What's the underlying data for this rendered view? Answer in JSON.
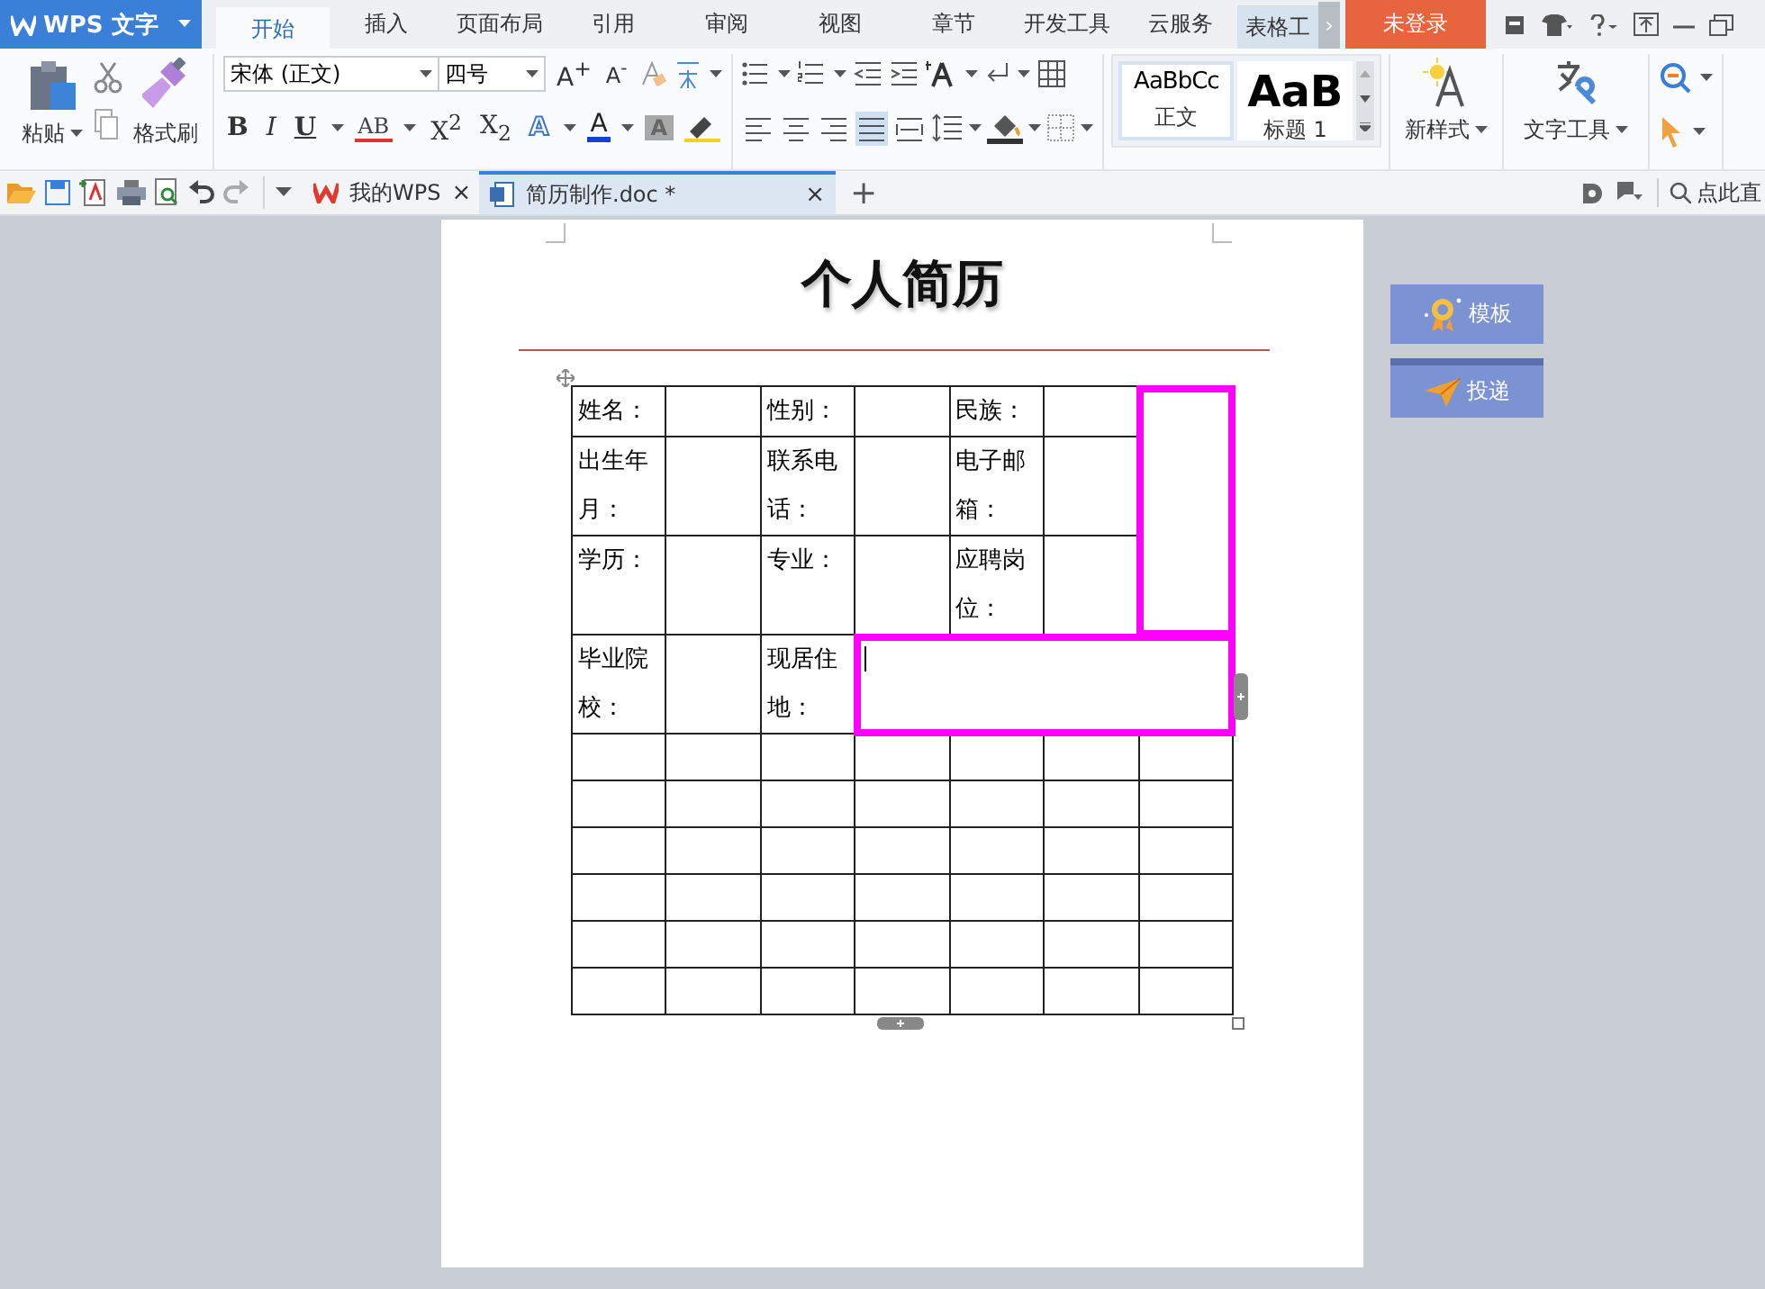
{
  "app": {
    "name": "WPS 文字"
  },
  "menu_tabs": [
    {
      "label": "开始",
      "selected": true
    },
    {
      "label": "插入",
      "selected": false
    },
    {
      "label": "页面布局",
      "selected": false
    },
    {
      "label": "引用",
      "selected": false
    },
    {
      "label": "审阅",
      "selected": false
    },
    {
      "label": "视图",
      "selected": false
    },
    {
      "label": "章节",
      "selected": false
    },
    {
      "label": "开发工具",
      "selected": false
    },
    {
      "label": "云服务",
      "selected": false
    },
    {
      "label": "表格工",
      "selected": false
    }
  ],
  "tab_scroll": "›",
  "login_button": "未登录",
  "ribbon": {
    "paste": "粘贴",
    "format_painter": "格式刷",
    "font_name": "宋体 (正文)",
    "font_size": "四号",
    "grow_font": "A$^{+}$",
    "shrink_font": "A$^{-}$",
    "font_styles": [
      {
        "label": "B",
        "kind": "bold"
      },
      {
        "label": "I",
        "kind": "italic"
      },
      {
        "label": "U",
        "kind": "underline"
      },
      {
        "label": "AB",
        "kind": "strike"
      },
      {
        "label": "X$^{2}$",
        "kind": "plain"
      },
      {
        "label": "X$_{2}$",
        "kind": "plain"
      },
      {
        "label": "A",
        "kind": "outline"
      },
      {
        "label": "A",
        "kind": "color"
      },
      {
        "label": "A",
        "kind": "shade"
      }
    ],
    "align_buttons": [
      {
        "selected": false
      },
      {
        "selected": false
      },
      {
        "selected": false
      },
      {
        "selected": true
      },
      {
        "selected": false
      }
    ],
    "styles": [
      {
        "sample": "AaBbCc",
        "label": "正文",
        "selected": true
      },
      {
        "sample": "AaB",
        "label": "标题 1",
        "selected": false
      }
    ],
    "new_style": "新样式",
    "text_tools": "文字工具"
  },
  "doc_tabs": [
    {
      "label": "我的WPS",
      "close": "×",
      "selected": false
    },
    {
      "label": "简历制作.doc *",
      "close": "×",
      "selected": true
    }
  ],
  "new_tab": "+",
  "search": {
    "placeholder": "点此直"
  },
  "document": {
    "title": "个人简历",
    "table": {
      "rows": [
        [
          {
            "text": "姓名：",
            "selected": false
          },
          {
            "text": "",
            "selected": false
          },
          {
            "text": "性别：",
            "selected": false
          },
          {
            "text": "",
            "selected": false
          },
          {
            "text": "民族：",
            "selected": false
          },
          {
            "text": "",
            "selected": false
          },
          {
            "text": "",
            "rowspan": 3,
            "selected": true
          }
        ],
        [
          {
            "text": "出生年月：",
            "selected": false
          },
          {
            "text": "",
            "selected": false
          },
          {
            "text": "联系电话：",
            "selected": false
          },
          {
            "text": "",
            "selected": false
          },
          {
            "text": "电子邮箱：",
            "selected": false
          },
          {
            "text": "",
            "selected": false
          }
        ],
        [
          {
            "text": "学历：",
            "selected": false
          },
          {
            "text": "",
            "selected": false
          },
          {
            "text": "专业：",
            "selected": false
          },
          {
            "text": "",
            "selected": false
          },
          {
            "text": "应聘岗位：",
            "selected": false
          },
          {
            "text": "",
            "selected": false
          }
        ],
        [
          {
            "text": "毕业院校：",
            "selected": false
          },
          {
            "text": "",
            "selected": false
          },
          {
            "text": "现居住地：",
            "selected": false
          },
          {
            "text": "",
            "colspan": 4,
            "selected": true,
            "cursor": true
          }
        ],
        [
          {
            "text": "",
            "selected": false
          },
          {
            "text": "",
            "selected": false
          },
          {
            "text": "",
            "selected": false
          },
          {
            "text": "",
            "selected": false
          },
          {
            "text": "",
            "selected": false
          },
          {
            "text": "",
            "selected": false
          },
          {
            "text": "",
            "selected": false
          }
        ],
        [
          {
            "text": "",
            "selected": false
          },
          {
            "text": "",
            "selected": false
          },
          {
            "text": "",
            "selected": false
          },
          {
            "text": "",
            "selected": false
          },
          {
            "text": "",
            "selected": false
          },
          {
            "text": "",
            "selected": false
          },
          {
            "text": "",
            "selected": false
          }
        ],
        [
          {
            "text": "",
            "selected": false
          },
          {
            "text": "",
            "selected": false
          },
          {
            "text": "",
            "selected": false
          },
          {
            "text": "",
            "selected": false
          },
          {
            "text": "",
            "selected": false
          },
          {
            "text": "",
            "selected": false
          },
          {
            "text": "",
            "selected": false
          }
        ],
        [
          {
            "text": "",
            "selected": false
          },
          {
            "text": "",
            "selected": false
          },
          {
            "text": "",
            "selected": false
          },
          {
            "text": "",
            "selected": false
          },
          {
            "text": "",
            "selected": false
          },
          {
            "text": "",
            "selected": false
          },
          {
            "text": "",
            "selected": false
          }
        ],
        [
          {
            "text": "",
            "selected": false
          },
          {
            "text": "",
            "selected": false
          },
          {
            "text": "",
            "selected": false
          },
          {
            "text": "",
            "selected": false
          },
          {
            "text": "",
            "selected": false
          },
          {
            "text": "",
            "selected": false
          },
          {
            "text": "",
            "selected": false
          }
        ],
        [
          {
            "text": "",
            "selected": false
          },
          {
            "text": "",
            "selected": false
          },
          {
            "text": "",
            "selected": false
          },
          {
            "text": "",
            "selected": false
          },
          {
            "text": "",
            "selected": false
          },
          {
            "text": "",
            "selected": false
          },
          {
            "text": "",
            "selected": false
          }
        ]
      ]
    }
  },
  "side_buttons": [
    {
      "label": "模板",
      "kind": "template"
    },
    {
      "label": "投递",
      "kind": "send"
    }
  ]
}
